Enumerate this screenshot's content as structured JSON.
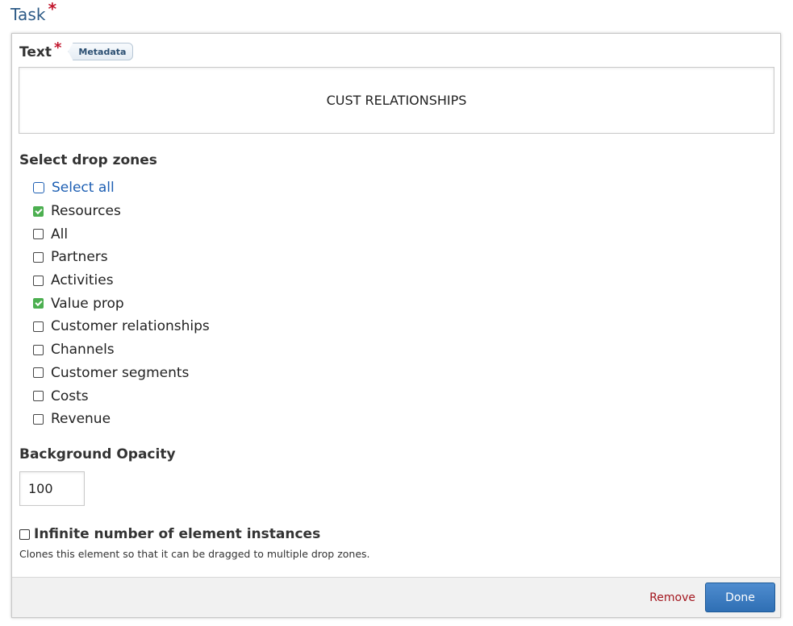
{
  "task": {
    "title": "Task",
    "required_mark": "*"
  },
  "text_field": {
    "label": "Text",
    "required_mark": "*",
    "metadata_label": "Metadata",
    "value": "CUST RELATIONSHIPS"
  },
  "drop_zones": {
    "label": "Select drop zones",
    "select_all_label": "Select all",
    "items": [
      {
        "label": "Resources",
        "checked": true
      },
      {
        "label": "All",
        "checked": false
      },
      {
        "label": "Partners",
        "checked": false
      },
      {
        "label": "Activities",
        "checked": false
      },
      {
        "label": "Value prop",
        "checked": true
      },
      {
        "label": "Customer relationships",
        "checked": false
      },
      {
        "label": "Channels",
        "checked": false
      },
      {
        "label": "Customer segments",
        "checked": false
      },
      {
        "label": "Costs",
        "checked": false
      },
      {
        "label": "Revenue",
        "checked": false
      }
    ]
  },
  "background_opacity": {
    "label": "Background Opacity",
    "value": "100"
  },
  "infinite_instances": {
    "label": "Infinite number of element instances",
    "description": "Clones this element so that it can be dragged to multiple drop zones.",
    "checked": false
  },
  "footer": {
    "remove_label": "Remove",
    "done_label": "Done"
  },
  "colors": {
    "title_blue": "#2c5a86",
    "required_red": "#c2172d",
    "checked_green": "#4caf50",
    "link_blue": "#1d5fb3",
    "remove_red": "#a3161e",
    "done_blue": "#2f6fb4"
  }
}
